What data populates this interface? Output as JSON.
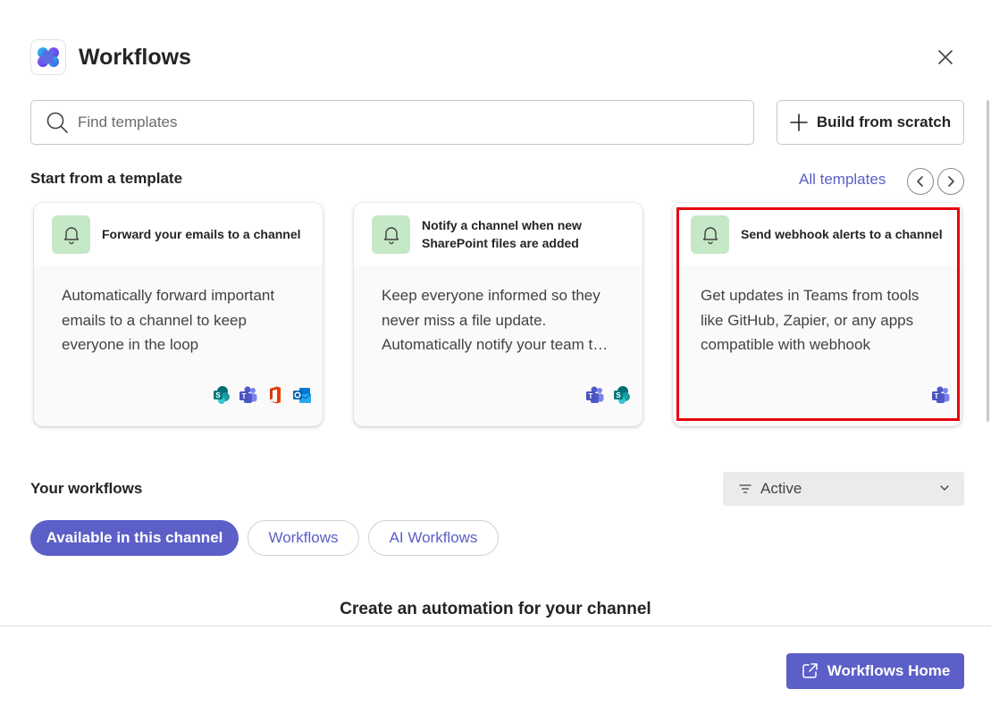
{
  "header": {
    "title": "Workflows",
    "logo_icon": "workflows-logo-icon",
    "close_icon": "close-icon"
  },
  "search": {
    "placeholder": "Find templates",
    "value": ""
  },
  "build_button": {
    "label": "Build from scratch",
    "icon": "plus-icon"
  },
  "templates_section": {
    "title": "Start from a template",
    "all_templates_label": "All templates",
    "cards": [
      {
        "title": "Forward your emails to a channel",
        "description": "Automatically forward important emails to a channel to keep everyone in the loop",
        "icon": "bell-icon",
        "apps": [
          "sharepoint-icon",
          "teams-icon",
          "office-icon",
          "outlook-icon"
        ]
      },
      {
        "title": "Notify a channel when new SharePoint files are added",
        "description": "Keep everyone informed so they never miss a file update. Automatically notify your team t…",
        "icon": "bell-icon",
        "apps": [
          "teams-icon",
          "sharepoint-icon"
        ]
      },
      {
        "title": "Send webhook alerts to a channel",
        "description": "Get updates in Teams from tools like GitHub, Zapier, or any apps compatible with webhook",
        "icon": "bell-icon",
        "apps": [
          "teams-icon"
        ]
      }
    ]
  },
  "workflows_section": {
    "title": "Your workflows",
    "filter": {
      "value": "Active",
      "icon": "filter-icon"
    },
    "tabs": [
      {
        "label": "Available in this channel",
        "active": true
      },
      {
        "label": "Workflows",
        "active": false
      },
      {
        "label": "AI Workflows",
        "active": false
      }
    ],
    "empty_title": "Create an automation for your channel"
  },
  "footer": {
    "home_button_label": "Workflows Home",
    "home_icon": "open-external-icon"
  },
  "colors": {
    "accent": "#5b5fc7",
    "card_icon_bg": "#c5e8c7",
    "highlight": "#e8000b"
  }
}
